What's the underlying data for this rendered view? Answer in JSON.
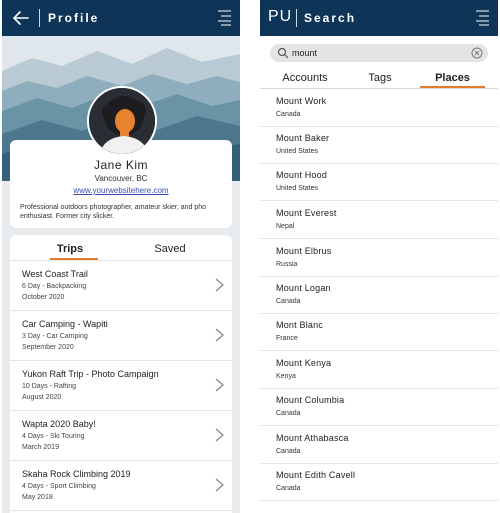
{
  "profile_screen": {
    "header": {
      "title": "Profile",
      "back_icon": "arrow-left-icon",
      "menu_icon": "hamburger-menu-icon"
    },
    "user": {
      "name": "Jane Kim",
      "location": "Vancouver, BC",
      "website": "www.yourwebsitehere.com",
      "bio": "Professional outdoors photographer, amateur skier, and pho enthusiast. Former city slicker."
    },
    "tabs": [
      {
        "label": "Trips",
        "active": true
      },
      {
        "label": "Saved",
        "active": false
      }
    ],
    "trips": [
      {
        "title": "West Coast Trail",
        "details": "6 Day - Backpacking",
        "date": "October 2020"
      },
      {
        "title": "Car Camping - Wapiti",
        "details": "3 Day - Car Camping",
        "date": "September 2020"
      },
      {
        "title": "Yukon Raft Trip - Photo Campaign",
        "details": "10 Days - Rafting",
        "date": "August 2020"
      },
      {
        "title": "Wapta 2020 Baby!",
        "details": "4 Days - Ski Touring",
        "date": "March 2019"
      },
      {
        "title": "Skaha Rock Climbing 2019",
        "details": "4 Days - Sport Climbing",
        "date": "May 2018"
      }
    ]
  },
  "search_screen": {
    "header": {
      "logo": "PU",
      "title": "Search",
      "menu_icon": "hamburger-menu-icon"
    },
    "search": {
      "value": "mount",
      "placeholder": ""
    },
    "tabs": [
      {
        "label": "Accounts",
        "active": false
      },
      {
        "label": "Tags",
        "active": false
      },
      {
        "label": "Places",
        "active": true
      }
    ],
    "places": [
      {
        "name": "Mount Work",
        "country": "Canada"
      },
      {
        "name": "Mount Baker",
        "country": "United States"
      },
      {
        "name": "Mount Hood",
        "country": "United States"
      },
      {
        "name": "Mount Everest",
        "country": "Nepal"
      },
      {
        "name": "Mount Elbrus",
        "country": "Russia"
      },
      {
        "name": "Mount Logan",
        "country": "Canada"
      },
      {
        "name": "Mont Blanc",
        "country": "France"
      },
      {
        "name": "Mount Kenya",
        "country": "Kenya"
      },
      {
        "name": "Mount Columbia",
        "country": "Canada"
      },
      {
        "name": "Mount Athabasca",
        "country": "Canada"
      },
      {
        "name": "Mount Edith Cavell",
        "country": "Canada"
      }
    ]
  },
  "colors": {
    "header": "#0e3557",
    "accent": "#e07b30",
    "link": "#3a4fb0"
  }
}
